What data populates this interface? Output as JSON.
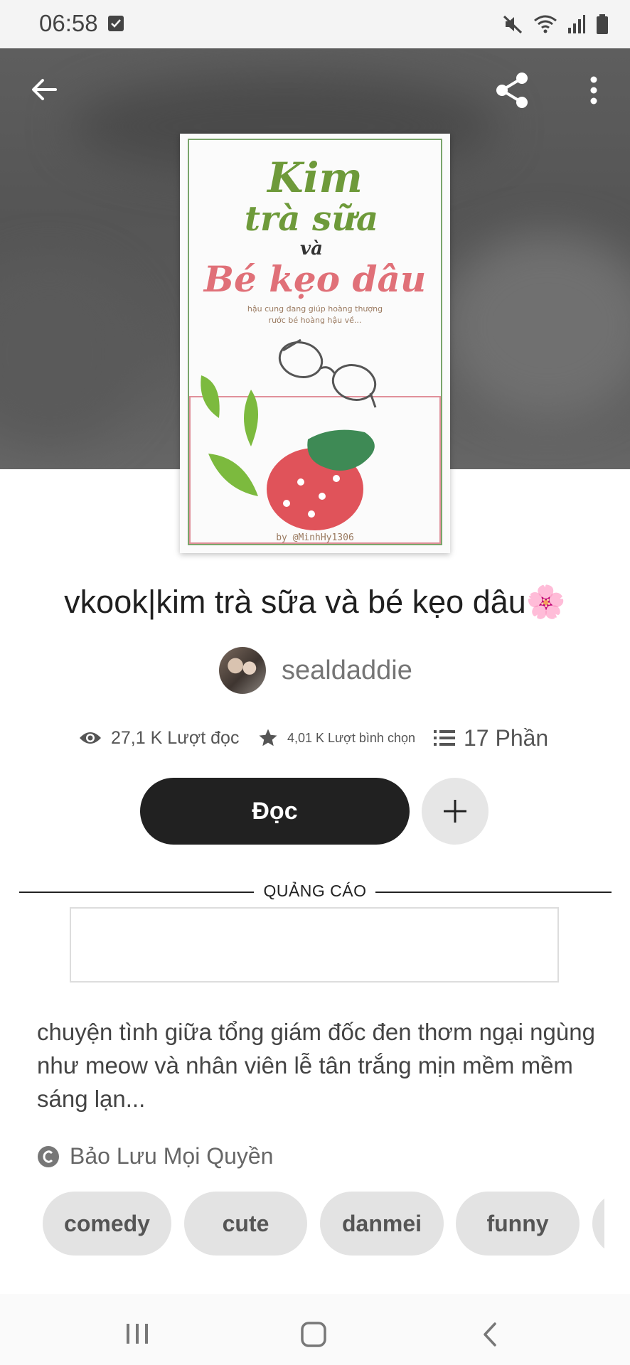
{
  "status_bar": {
    "time": "06:58"
  },
  "book": {
    "title": "vkook|kim trà sữa và bé kẹo dâu🌸",
    "author": "sealdaddie",
    "cover": {
      "line1": "Kim",
      "line2": "trà sữa",
      "line3": "và",
      "line4": "Bé kẹo dâu",
      "tagline1": "hậu cung đang giúp hoàng thượng",
      "tagline2": "rước bé hoàng hậu về...",
      "byline": "by @MinhHy1306"
    }
  },
  "stats": {
    "reads": "27,1 K Lượt đọc",
    "votes": "4,01 K Lượt bình chọn",
    "parts": "17 Phần"
  },
  "actions": {
    "read_label": "Đọc"
  },
  "ad": {
    "label": "QUẢNG CÁO"
  },
  "description": "chuyện tình giữa tổng giám đốc đen thơm ngại ngùng như meow và nhân viên lễ tân trắng mịn mềm mềm sáng lạn...",
  "copyright": "Bảo Lưu Mọi Quyền",
  "tags": [
    "comedy",
    "cute",
    "danmei",
    "funny"
  ],
  "colors": {
    "accent_dark": "#212121",
    "tag_bg": "#e3e3e3",
    "cover_green": "#6e9a3a",
    "cover_pink": "#e07078"
  },
  "icons": [
    "back-arrow-icon",
    "share-icon",
    "more-vert-icon",
    "eye-icon",
    "star-icon",
    "list-icon",
    "plus-icon",
    "copyright-icon",
    "nav-recents-icon",
    "nav-home-icon",
    "nav-back-icon"
  ]
}
